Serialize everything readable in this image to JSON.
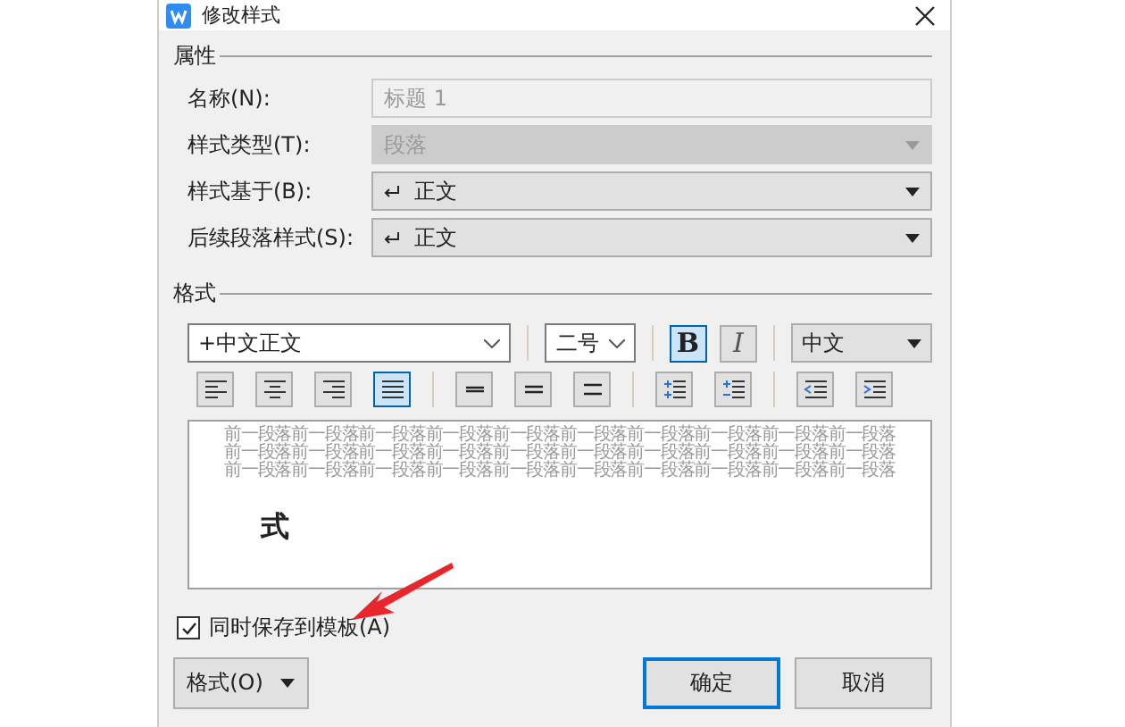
{
  "window": {
    "title": "修改样式"
  },
  "properties": {
    "heading": "属性",
    "fields": [
      {
        "kind": "text",
        "label": "名称(N):",
        "value": "标题 1",
        "disabled": true
      },
      {
        "kind": "select",
        "label": "样式类型(T):",
        "value": "段落",
        "disabled": true
      },
      {
        "kind": "select",
        "label": "样式基于(B):",
        "value": "正文",
        "disabled": false
      },
      {
        "kind": "select",
        "label": "后续段落样式(S):",
        "value": "正文",
        "disabled": false
      }
    ]
  },
  "format": {
    "heading": "格式",
    "font": "+中文正文",
    "size": "二号",
    "bold": {
      "label": "B",
      "selected": true
    },
    "italic": {
      "label": "I",
      "selected": false
    },
    "script": "中文",
    "tools": [
      {
        "kind": "align-left",
        "selected": false
      },
      {
        "kind": "align-center",
        "selected": false
      },
      {
        "kind": "align-right",
        "selected": false
      },
      {
        "kind": "align-justify",
        "selected": true
      },
      {
        "kind": "sep"
      },
      {
        "kind": "spacing-single",
        "selected": false
      },
      {
        "kind": "spacing-onehalf",
        "selected": false
      },
      {
        "kind": "spacing-double",
        "selected": false
      },
      {
        "kind": "sep"
      },
      {
        "kind": "para-increase",
        "selected": false
      },
      {
        "kind": "para-decrease",
        "selected": false
      },
      {
        "kind": "sep"
      },
      {
        "kind": "indent-decrease",
        "selected": false
      },
      {
        "kind": "indent-increase",
        "selected": false
      }
    ],
    "preview": {
      "lines": [
        "前一段落前一段落前一段落前一段落前一段落前一段落前一段落前一段落前一段落前一段落",
        "前一段落前一段落前一段落前一段落前一段落前一段落前一段落前一段落前一段落前一段落",
        "前一段落前一段落前一段落前一段落前一段落前一段落前一段落前一段落前一段落前一段落"
      ],
      "sample": "式"
    }
  },
  "save_to_template": {
    "label": "同时保存到模板(A)",
    "checked": true
  },
  "buttons": {
    "format": "格式(O)",
    "ok": "确定",
    "cancel": "取消"
  }
}
